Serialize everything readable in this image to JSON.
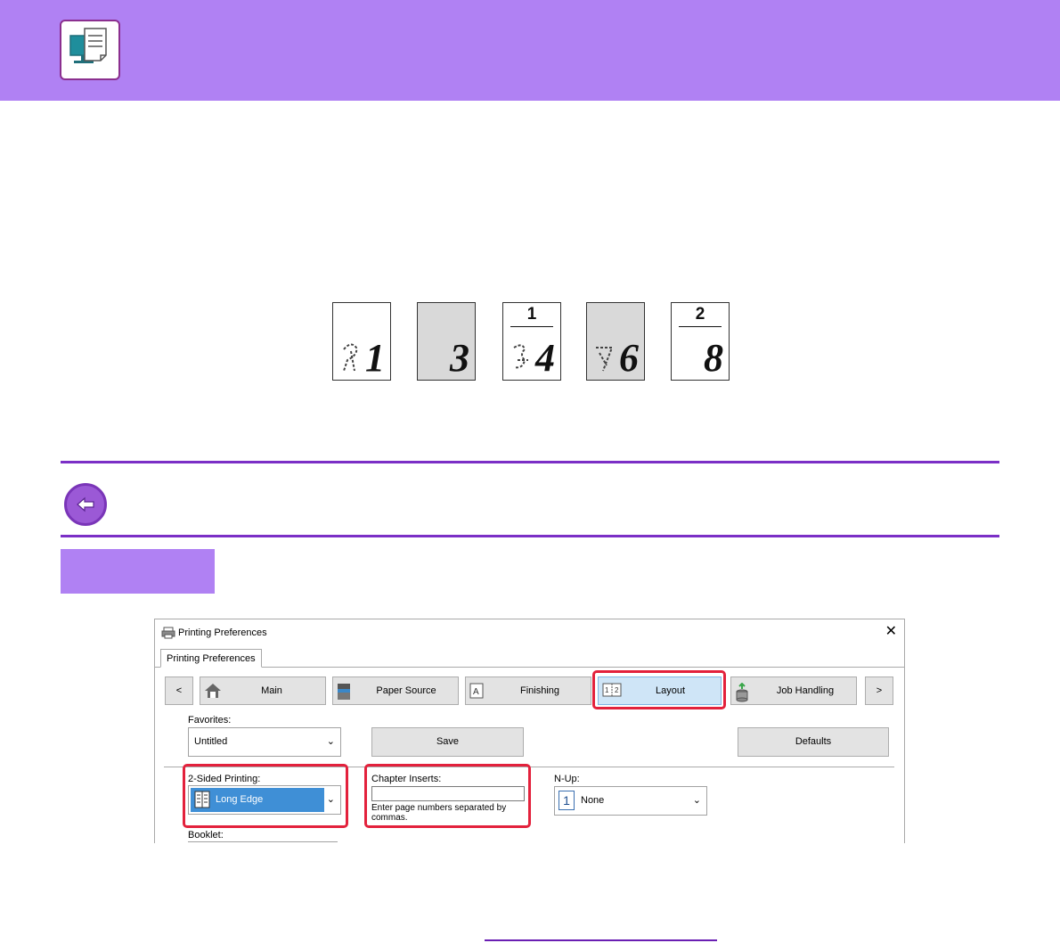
{
  "colors": {
    "header_band": "#b081f3",
    "rule": "#7b2fc6",
    "highlight": "#e3213c",
    "selected_combo": "#3f8fd6"
  },
  "header": {
    "icon": "print-to-monitor-icon"
  },
  "page_examples": {
    "pages": [
      {
        "number": "1",
        "shaded": false,
        "chapter": ""
      },
      {
        "number": "3",
        "shaded": true,
        "chapter": ""
      },
      {
        "number": "4",
        "shaded": false,
        "chapter": "1"
      },
      {
        "number": "6",
        "shaded": true,
        "chapter": ""
      },
      {
        "number": "8",
        "shaded": false,
        "chapter": "2"
      }
    ]
  },
  "back_button": {
    "icon": "return-arrow-icon"
  },
  "dialog": {
    "title": "Printing Preferences",
    "close_glyph": "✕",
    "tab_label": "Printing Preferences",
    "nav": {
      "prev": "<",
      "next": ">",
      "buttons": [
        {
          "label": "Main",
          "icon": "home-icon"
        },
        {
          "label": "Paper Source",
          "icon": "printer-tray-icon"
        },
        {
          "label": "Finishing",
          "icon": "finishing-icon"
        },
        {
          "label": "Layout",
          "icon": "layout-icon",
          "active": true
        },
        {
          "label": "Job Handling",
          "icon": "job-handling-icon"
        }
      ]
    },
    "favorites": {
      "label": "Favorites:",
      "value": "Untitled"
    },
    "save_label": "Save",
    "defaults_label": "Defaults",
    "two_sided": {
      "label": "2-Sided Printing:",
      "value": "Long Edge"
    },
    "chapter_inserts": {
      "label": "Chapter Inserts:",
      "value": "",
      "hint": "Enter page numbers separated by commas."
    },
    "nup": {
      "label": "N-Up:",
      "value": "None",
      "icon_digit": "1"
    },
    "booklet": {
      "label": "Booklet:"
    }
  }
}
